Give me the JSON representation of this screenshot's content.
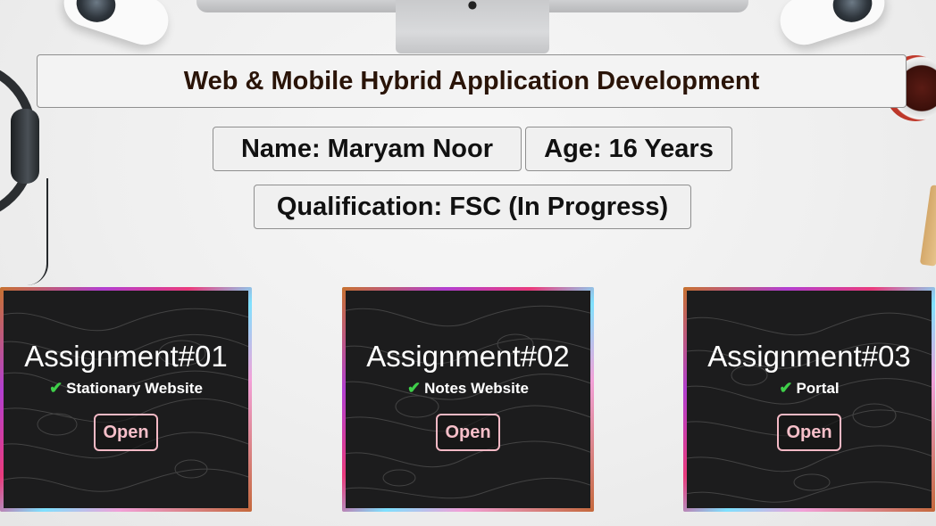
{
  "header": {
    "title": "Web & Mobile Hybrid Application Development"
  },
  "profile": {
    "name": "Name: Maryam Noor",
    "age": "Age: 16 Years",
    "qualification": "Qualification: FSC (In Progress)"
  },
  "assignments": [
    {
      "title": "Assignment#01",
      "subtitle": "Stationary Website",
      "button": "Open"
    },
    {
      "title": "Assignment#02",
      "subtitle": "Notes Website",
      "button": "Open"
    },
    {
      "title": "Assignment#03",
      "subtitle": "Portal",
      "button": "Open"
    }
  ],
  "icons": {
    "check": "check-icon",
    "logo": "apple-logo"
  },
  "colors": {
    "title_text": "#2a1408",
    "card_background": "#1c1c1d",
    "button_accent": "#f4b9c5",
    "check_green": "#3fcf4a"
  }
}
